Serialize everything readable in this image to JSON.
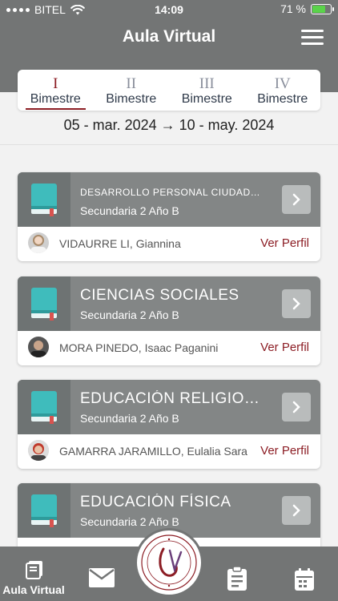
{
  "status_bar": {
    "carrier": "BITEL",
    "time": "14:09",
    "battery": "71 %",
    "battery_level": 0.71,
    "battery_color": "#5ad34a"
  },
  "header": {
    "title": "Aula Virtual"
  },
  "bimester_tabs": [
    {
      "roman": "I",
      "label": "Bimestre",
      "active": true
    },
    {
      "roman": "II",
      "label": "Bimestre",
      "active": false
    },
    {
      "roman": "III",
      "label": "Bimestre",
      "active": false
    },
    {
      "roman": "IV",
      "label": "Bimestre",
      "active": false
    }
  ],
  "date_range": "05 - mar. 2024 → 10 - may. 2024",
  "courses": [
    {
      "name": "DESARROLLO PERSONAL CIUDADA...",
      "grade": "Secundaria 2 Año B",
      "teacher": "VIDAURRE LI, Giannina",
      "profile_label": "Ver Perfil"
    },
    {
      "name": "CIENCIAS SOCIALES",
      "grade": "Secundaria 2 Año B",
      "teacher": "MORA PINEDO, Isaac Paganini",
      "profile_label": "Ver Perfil"
    },
    {
      "name": "EDUCACIÓN RELIGIOSA",
      "grade": "Secundaria 2 Año B",
      "teacher": "GAMARRA JARAMILLO, Eulalia Sara",
      "profile_label": "Ver Perfil"
    },
    {
      "name": "EDUCACIÓN FÍSICA",
      "grade": "Secundaria 2 Año B",
      "teacher": "",
      "profile_label": ""
    }
  ],
  "tab_bar": {
    "items": [
      {
        "icon": "book-stack-icon",
        "label": "Aula Virtual",
        "active": true
      },
      {
        "icon": "mail-icon",
        "label": ""
      },
      {
        "icon": "school-logo",
        "label": ""
      },
      {
        "icon": "clipboard-icon",
        "label": ""
      },
      {
        "icon": "calendar-icon",
        "label": ""
      }
    ]
  },
  "colors": {
    "header": "#737575",
    "accent": "#8c1d24",
    "book": "#3fbcbc",
    "card_top": "#838686"
  }
}
